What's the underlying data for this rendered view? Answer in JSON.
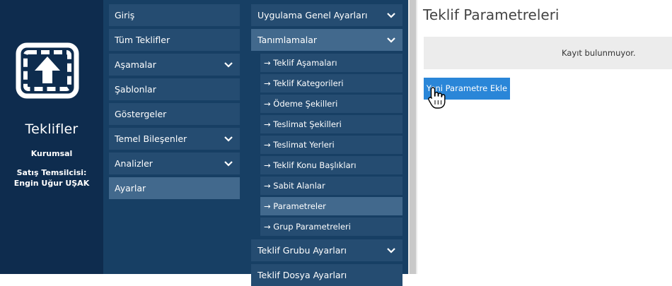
{
  "brand": {
    "app_title": "Teklifler",
    "subtitle": "Kurumsal",
    "rep_label": "Satış Temsilcisi:",
    "rep_name": "Engin Uğur UŞAK",
    "logo_icon": "upload-frame-icon"
  },
  "menu1": {
    "items": [
      {
        "label": "Giriş",
        "has_chevron": false
      },
      {
        "label": "Tüm Teklifler",
        "has_chevron": false
      },
      {
        "label": "Aşamalar",
        "has_chevron": true
      },
      {
        "label": "Şablonlar",
        "has_chevron": false
      },
      {
        "label": "Göstergeler",
        "has_chevron": false
      },
      {
        "label": "Temel Bileşenler",
        "has_chevron": true
      },
      {
        "label": "Analizler",
        "has_chevron": true
      },
      {
        "label": "Ayarlar",
        "has_chevron": false,
        "active": true
      }
    ]
  },
  "menu2": {
    "general": "Uygulama Genel Ayarları",
    "definitions": "Tanımlamalar",
    "sub_items": [
      "→ Teklif Aşamaları",
      "→ Teklif Kategorileri",
      "→ Ödeme Şekilleri",
      "→ Teslimat Şekilleri",
      "→ Teslimat Yerleri",
      "→ Teklif Konu Başlıkları",
      "→ Sabit Alanlar",
      "→ Parametreler",
      "→ Grup Parametreleri"
    ],
    "active_sub": "→ Parametreler",
    "group_settings": "Teklif Grubu Ayarları",
    "partial_item": "Teklif Dosya Ayarları"
  },
  "content": {
    "title": "Teklif Parametreleri",
    "empty_message": "Kayıt bulunmuyor.",
    "add_button": "Yeni Parametre Ekle"
  },
  "colors": {
    "brand_bg": "#0e2c4e",
    "menu_bg": "#173f64",
    "item_bg": "#254c71",
    "item_active": "#42698d",
    "button": "#2a86d8"
  }
}
